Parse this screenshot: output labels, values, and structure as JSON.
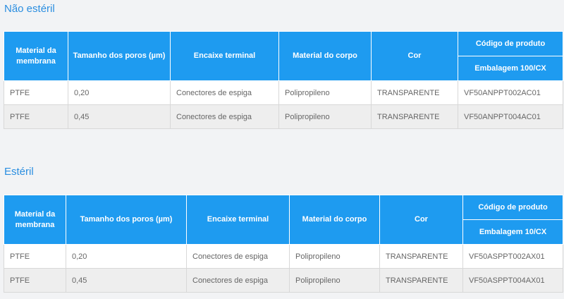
{
  "sections": [
    {
      "title": "Não estéril",
      "headers": {
        "membrane": "Material da membrana",
        "pore_size": "Tamanho dos poros (µm)",
        "terminal": "Encaixe terminal",
        "body": "Material do corpo",
        "color": "Cor",
        "product_code": "Código de produto",
        "packaging": "Embalagem 100/CX"
      },
      "rows": [
        [
          "PTFE",
          "0,20",
          "Conectores de espiga",
          "Polipropileno",
          "TRANSPARENTE",
          "VF50ANPPT002AC01"
        ],
        [
          "PTFE",
          "0,45",
          "Conectores de espiga",
          "Polipropileno",
          "TRANSPARENTE",
          "VF50ANPPT004AC01"
        ]
      ]
    },
    {
      "title": "Estéril",
      "headers": {
        "membrane": "Material da membrana",
        "pore_size": "Tamanho dos poros (µm)",
        "terminal": "Encaixe terminal",
        "body": "Material do corpo",
        "color": "Cor",
        "product_code": "Código de produto",
        "packaging": "Embalagem 10/CX"
      },
      "rows": [
        [
          "PTFE",
          "0,20",
          "Conectores de espiga",
          "Polipropileno",
          "TRANSPARENTE",
          "VF50ASPPT002AX01"
        ],
        [
          "PTFE",
          "0,45",
          "Conectores de espiga",
          "Polipropileno",
          "TRANSPARENTE",
          "VF50ASPPT004AX01"
        ]
      ]
    }
  ]
}
